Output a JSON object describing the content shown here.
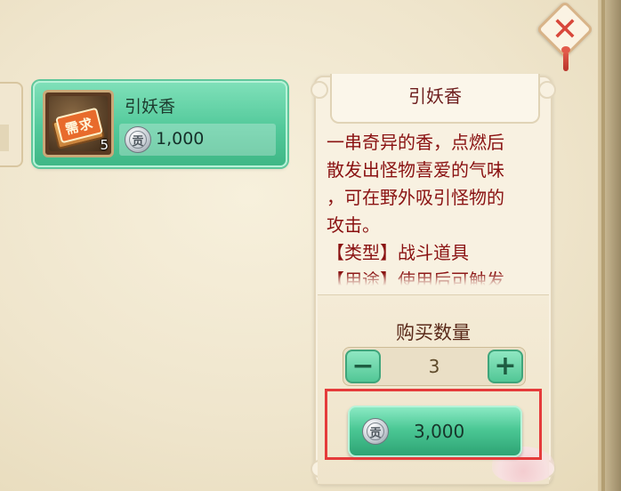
{
  "item_card": {
    "name": "引妖香",
    "need_badge": "需求",
    "count": "5",
    "price": "1,000",
    "currency_icon": "coin-gong-icon"
  },
  "detail": {
    "title": "引妖香",
    "description_lines": [
      "一串奇异的香，点燃后",
      "散发出怪物喜爱的气味",
      "，可在野外吸引怪物的",
      "攻击。",
      "【类型】战斗道具",
      "【用途】使用后可触发"
    ]
  },
  "purchase": {
    "quantity_label": "购买数量",
    "minus_symbol": "−",
    "plus_symbol": "+",
    "quantity": "3",
    "total_price": "3,000",
    "currency_glyph": "贡"
  },
  "close": {
    "symbol": "✕"
  },
  "colors": {
    "accent_green": "#52c99a",
    "title_red": "#6d1d1d",
    "desc_red": "#8a1212",
    "highlight_red": "#e53b3b",
    "panel_bg": "#f8f1e1"
  }
}
